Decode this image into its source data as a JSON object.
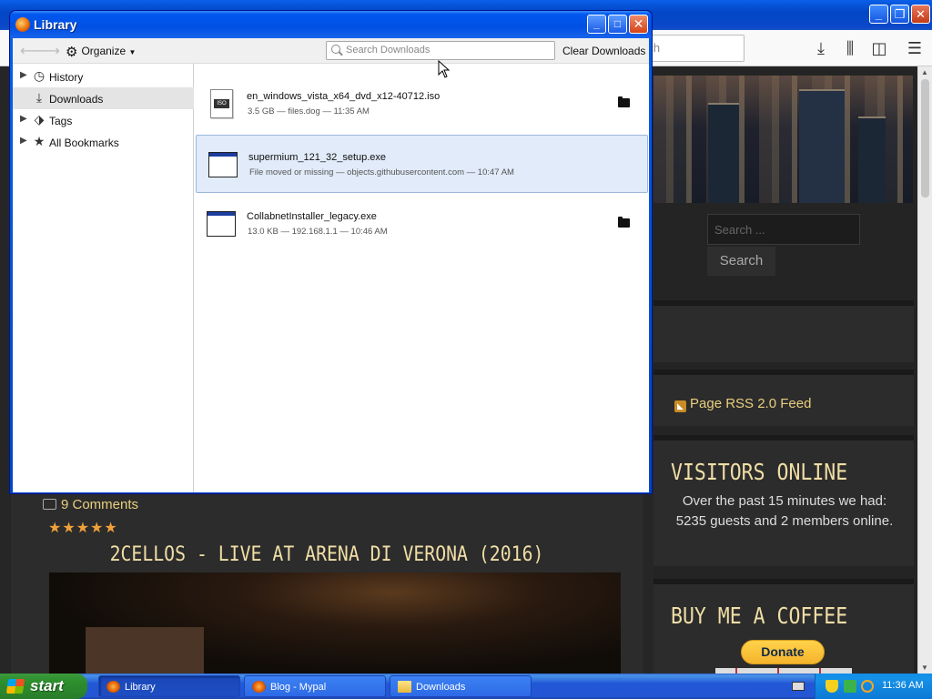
{
  "browser": {
    "search_placeholder": "rch",
    "sidebar": {
      "search_placeholder": "Search ...",
      "search_button": "Search",
      "rss_link": "Page RSS 2.0 Feed",
      "visitors_title": "VISITORS ONLINE",
      "visitors_text": "Over the past 15 minutes we had: 5235 guests and 2 members online.",
      "coffee_title": "BUY ME A COFFEE",
      "donate_label": "Donate"
    },
    "post": {
      "comments": "9 Comments",
      "stars": "★★★★★",
      "title": "2CELLOS - LIVE AT ARENA DI VERONA (2016)"
    }
  },
  "library": {
    "title": "Library",
    "toolbar": {
      "organize_label": "Organize",
      "search_placeholder": "Search Downloads",
      "clear_label": "Clear Downloads"
    },
    "sidebar": [
      {
        "label": "History",
        "icon": "clock-icon"
      },
      {
        "label": "Downloads",
        "icon": "download-icon"
      },
      {
        "label": "Tags",
        "icon": "tag-icon"
      },
      {
        "label": "All Bookmarks",
        "icon": "star-icon"
      }
    ],
    "downloads": [
      {
        "name": "en_windows_vista_x64_dvd_x12-40712.iso",
        "status": "3.5 GB — files.dog — 11:35 AM",
        "icon": "iso-file-icon"
      },
      {
        "name": "supermium_121_32_setup.exe",
        "status": "File moved or missing — objects.githubusercontent.com — 10:47 AM",
        "icon": "exe-file-icon"
      },
      {
        "name": "CollabnetInstaller_legacy.exe",
        "status": "13.0 KB — 192.168.1.1 — 10:46 AM",
        "icon": "exe-file-icon"
      }
    ]
  },
  "taskbar": {
    "start_label": "start",
    "tasks": [
      {
        "label": "Library"
      },
      {
        "label": "Blog - Mypal"
      },
      {
        "label": "Downloads"
      }
    ],
    "clock": "11:36 AM"
  },
  "colors": {
    "xp_blue": "#0050e4",
    "accent_gold": "#f0dea6",
    "link_gold": "#e9cf7f",
    "selected_row": "#e1ebf9"
  }
}
